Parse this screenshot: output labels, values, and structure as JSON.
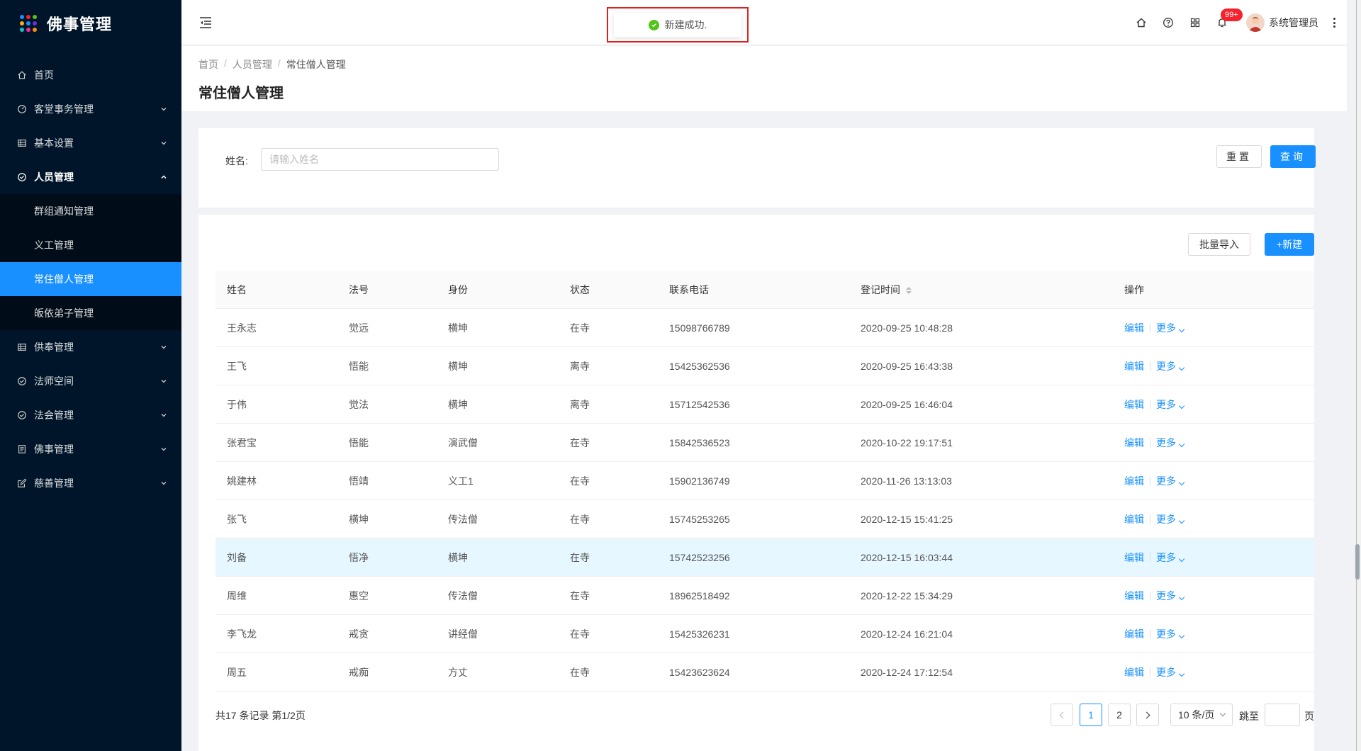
{
  "app": {
    "logo_text": "佛事管理",
    "logo_dot_colors": [
      "#1890ff",
      "#f5222d",
      "#52c41a",
      "#faad14",
      "#1890ff",
      "#722ed1",
      "#13c2c2",
      "#eb2f96",
      "#fa8c16"
    ]
  },
  "sidebar": {
    "items": [
      {
        "label": "首页",
        "icon": "home-icon"
      },
      {
        "label": "客堂事务管理",
        "icon": "dashboard-icon"
      },
      {
        "label": "基本设置",
        "icon": "table-icon"
      },
      {
        "label": "人员管理",
        "icon": "check-circle-icon"
      },
      {
        "label": "供奉管理",
        "icon": "table-icon"
      },
      {
        "label": "法师空间",
        "icon": "check-circle-icon"
      },
      {
        "label": "法会管理",
        "icon": "check-circle-icon"
      },
      {
        "label": "佛事管理",
        "icon": "profile-icon"
      },
      {
        "label": "慈善管理",
        "icon": "form-icon"
      }
    ],
    "submenu": [
      {
        "label": "群组通知管理"
      },
      {
        "label": "义工管理"
      },
      {
        "label": "常住僧人管理"
      },
      {
        "label": "皈依弟子管理"
      }
    ],
    "colors": {
      "bg": "#001529",
      "active": "#1890ff"
    }
  },
  "header": {
    "toast": "新建成功.",
    "badge": "99+",
    "username": "系统管理员"
  },
  "breadcrumb": [
    "首页",
    "人员管理",
    "常住僧人管理"
  ],
  "page_title": "常住僧人管理",
  "search": {
    "label": "姓名:",
    "placeholder": "请输入姓名",
    "value": "",
    "reset": "重置",
    "query": "查询"
  },
  "actions": {
    "import": "批量导入",
    "new": "+新建"
  },
  "table": {
    "columns": [
      "姓名",
      "法号",
      "身份",
      "状态",
      "联系电话",
      "登记时间",
      "操作"
    ],
    "rows": [
      {
        "name": "王永志",
        "dharma": "觉远",
        "identity": "横坤",
        "status": "在寺",
        "phone": "15098766789",
        "time": "2020-09-25 10:48:28"
      },
      {
        "name": "王飞",
        "dharma": "悟能",
        "identity": "横坤",
        "status": "离寺",
        "phone": "15425362536",
        "time": "2020-09-25 16:43:38"
      },
      {
        "name": "于伟",
        "dharma": "觉法",
        "identity": "横坤",
        "status": "离寺",
        "phone": "15712542536",
        "time": "2020-09-25 16:46:04"
      },
      {
        "name": "张君宝",
        "dharma": "悟能",
        "identity": "演武僧",
        "status": "在寺",
        "phone": "15842536523",
        "time": "2020-10-22 19:17:51"
      },
      {
        "name": "姚建林",
        "dharma": "悟靖",
        "identity": "义工1",
        "status": "在寺",
        "phone": "15902136749",
        "time": "2020-11-26 13:13:03"
      },
      {
        "name": "张飞",
        "dharma": "横坤",
        "identity": "传法僧",
        "status": "在寺",
        "phone": "15745253265",
        "time": "2020-12-15 15:41:25"
      },
      {
        "name": "刘备",
        "dharma": "悟净",
        "identity": "横坤",
        "status": "在寺",
        "phone": "15742523256",
        "time": "2020-12-15 16:03:44"
      },
      {
        "name": "周维",
        "dharma": "惠空",
        "identity": "传法僧",
        "status": "在寺",
        "phone": "18962518492",
        "time": "2020-12-22 15:34:29"
      },
      {
        "name": "李飞龙",
        "dharma": "戒贪",
        "identity": "讲经僧",
        "status": "在寺",
        "phone": "15425326231",
        "time": "2020-12-24 16:21:04"
      },
      {
        "name": "周五",
        "dharma": "戒痴",
        "identity": "方丈",
        "status": "在寺",
        "phone": "15423623624",
        "time": "2020-12-24 17:12:54"
      }
    ],
    "edit_label": "编辑",
    "more_label": "更多",
    "highlight_row": 6
  },
  "pagination": {
    "summary": "共17 条记录 第1/2页",
    "pages": [
      "1",
      "2"
    ],
    "current": "1",
    "page_size": "10 条/页",
    "jump_label": "跳至",
    "page_label": "页"
  }
}
